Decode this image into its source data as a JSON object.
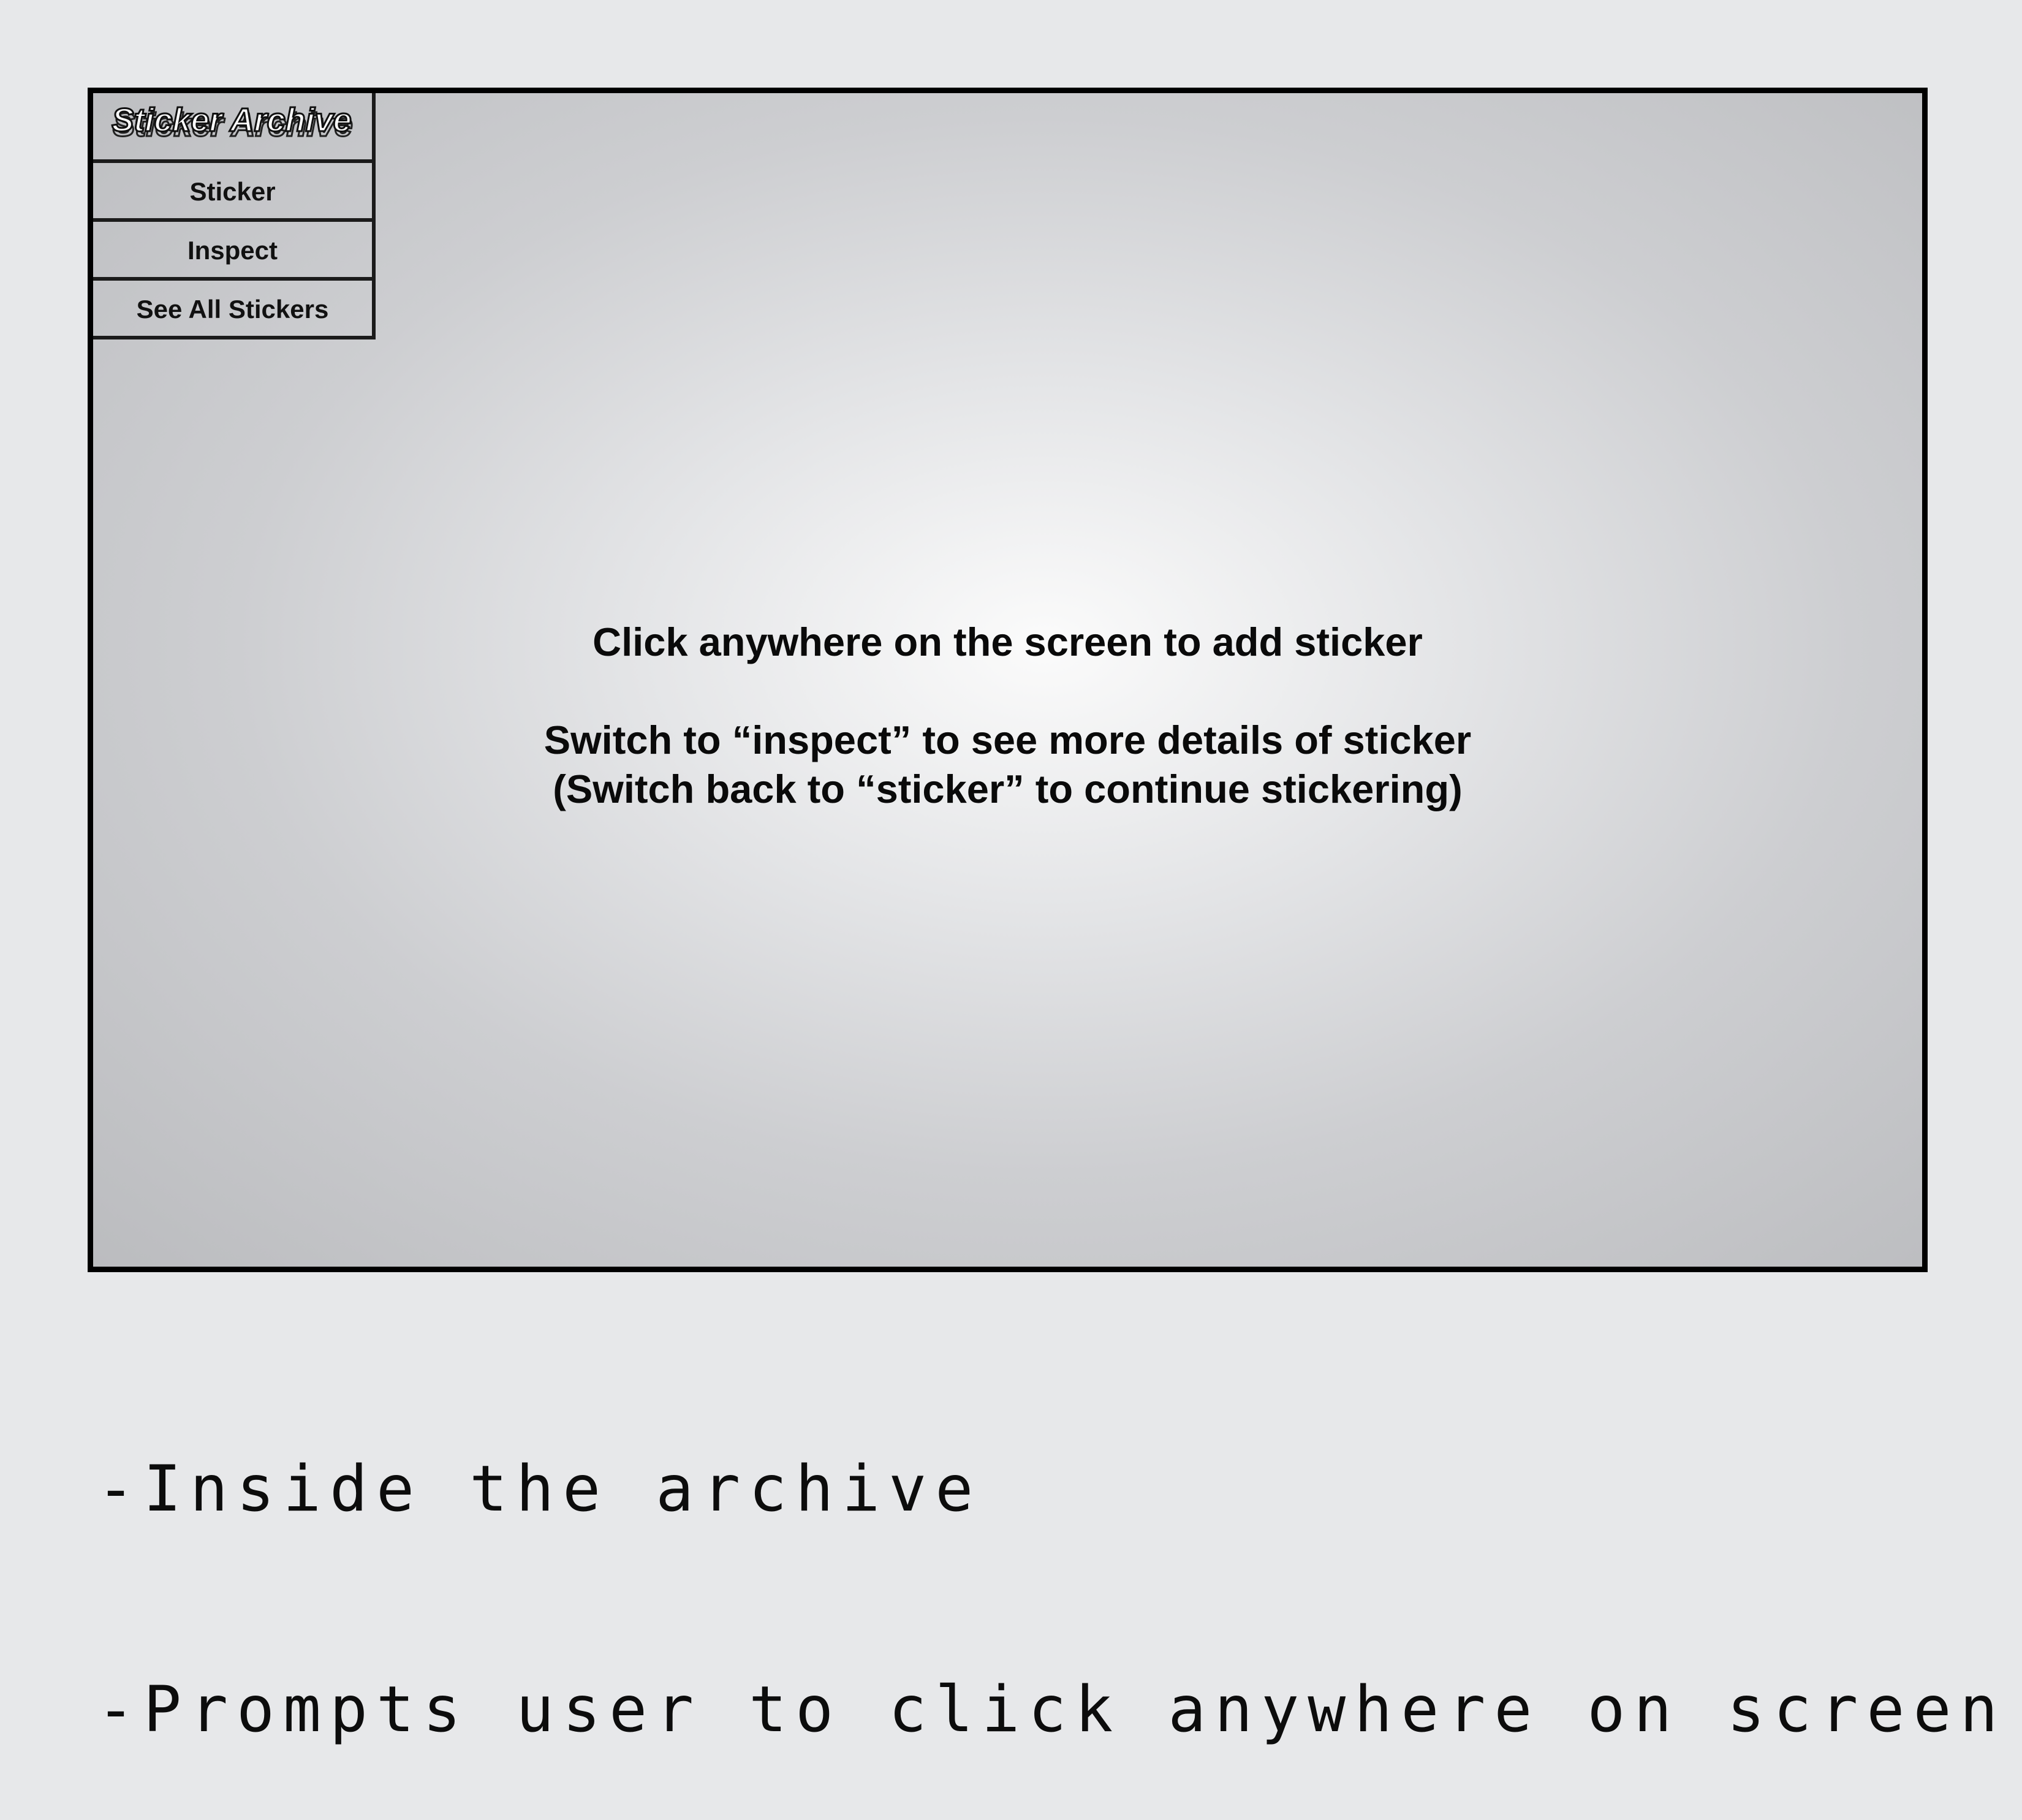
{
  "menu": {
    "logo_text": "Sticker Archive",
    "items": [
      {
        "label": "Sticker"
      },
      {
        "label": "Inspect"
      },
      {
        "label": "See All Stickers"
      }
    ]
  },
  "instructions": {
    "line1": "Click anywhere on the screen to add sticker",
    "line2": "Switch to “inspect” to see more details of sticker",
    "line3": "(Switch back to “sticker” to continue stickering)"
  },
  "caption": {
    "line1": "-Inside the archive",
    "line2": "-Prompts user to click anywhere on screen"
  }
}
